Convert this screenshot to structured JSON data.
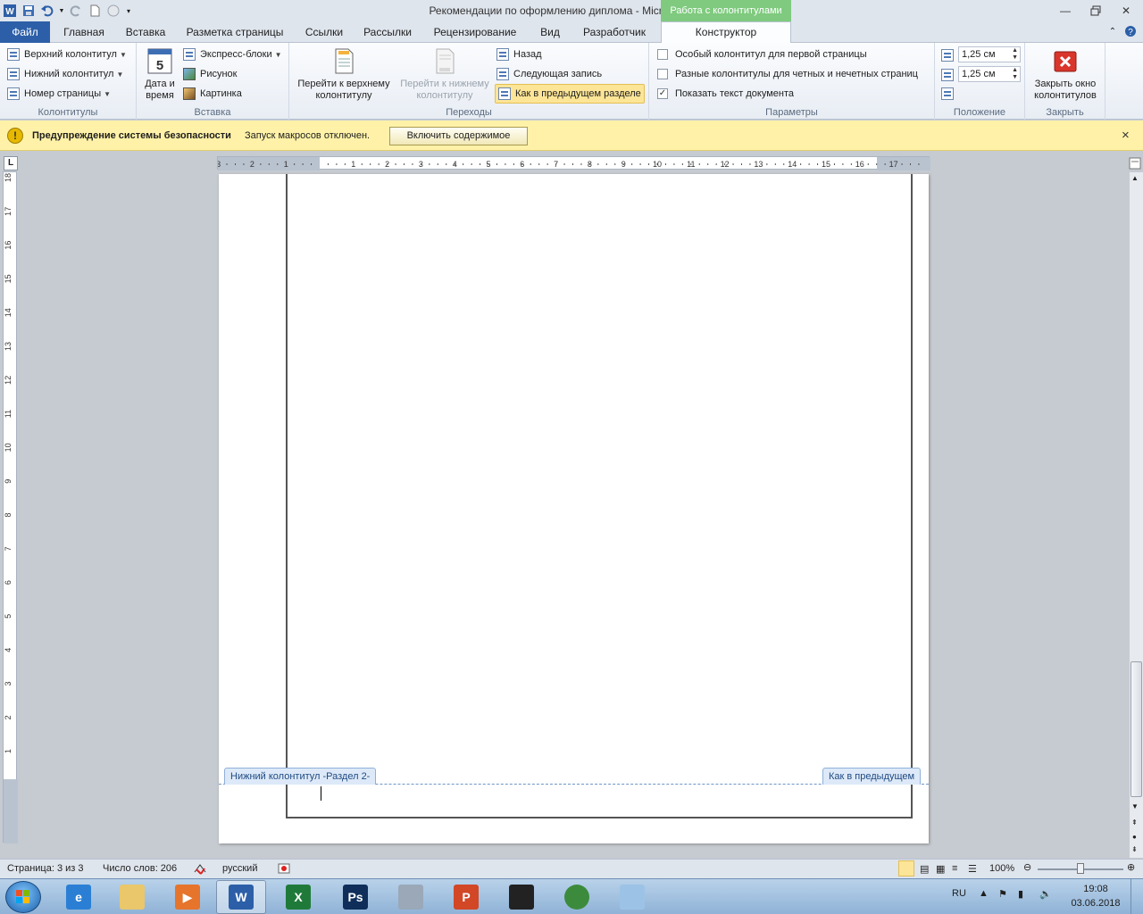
{
  "window": {
    "title": "Рекомендации по оформлению диплома  -  Microsoft Word",
    "context_tab_group": "Работа с колонтитулами"
  },
  "tabs": {
    "file": "Файл",
    "items": [
      "Главная",
      "Вставка",
      "Разметка страницы",
      "Ссылки",
      "Рассылки",
      "Рецензирование",
      "Вид"
    ],
    "addin": "Разработчик",
    "active": "Конструктор"
  },
  "ribbon": {
    "headers_group": {
      "label": "Колонтитулы",
      "header": "Верхний колонтитул",
      "footer": "Нижний колонтитул",
      "page_number": "Номер страницы"
    },
    "insert_group": {
      "label": "Вставка",
      "date_time": "Дата и время",
      "date_glyph": "5",
      "quick_parts": "Экспресс-блоки",
      "picture": "Рисунок",
      "clipart": "Картинка"
    },
    "nav_group": {
      "label": "Переходы",
      "goto_header": "Перейти к верхнему колонтитулу",
      "goto_footer": "Перейти к нижнему колонтитулу",
      "prev": "Назад",
      "next": "Следующая запись",
      "link_prev": "Как в предыдущем разделе"
    },
    "options_group": {
      "label": "Параметры",
      "diff_first": "Особый колонтитул для первой страницы",
      "diff_odd_even": "Разные колонтитулы для четных и нечетных страниц",
      "show_doc_text": "Показать текст документа",
      "show_doc_text_checked": true
    },
    "position_group": {
      "label": "Положение",
      "header_from_top": "1,25 см",
      "footer_from_bottom": "1,25 см"
    },
    "close_group": {
      "label": "Закрыть",
      "close": "Закрыть окно колонтитулов"
    }
  },
  "security_bar": {
    "title": "Предупреждение системы безопасности",
    "message": "Запуск макросов отключен.",
    "button": "Включить содержимое",
    "close": "×"
  },
  "ruler": {
    "horizontal_numbers": [
      "3",
      "2",
      "1",
      "1",
      "2",
      "3",
      "4",
      "5",
      "6",
      "7",
      "8",
      "9",
      "10",
      "11",
      "12",
      "13",
      "14",
      "15",
      "16",
      "17"
    ],
    "vertical_numbers": [
      "18",
      "17",
      "16",
      "15",
      "14",
      "13",
      "12",
      "11",
      "10",
      "9",
      "8",
      "7",
      "6",
      "5",
      "4",
      "3",
      "2",
      "1"
    ],
    "corner": "L"
  },
  "document": {
    "footer_tag": "Нижний колонтитул -Раздел 2-",
    "link_tag": "Как в предыдущем"
  },
  "status": {
    "page": "Страница: 3 из 3",
    "words": "Число слов: 206",
    "language": "русский",
    "zoom": "100%"
  },
  "taskbar": {
    "apps": [
      {
        "name": "ie",
        "glyph": "e",
        "color": "#2a7fd4"
      },
      {
        "name": "explorer",
        "glyph": "",
        "color": "#e9c76a"
      },
      {
        "name": "media",
        "glyph": "▶",
        "color": "#e6742b"
      },
      {
        "name": "word",
        "glyph": "W",
        "color": "#2c5fa8"
      },
      {
        "name": "excel",
        "glyph": "X",
        "color": "#1f7a3a"
      },
      {
        "name": "photoshop",
        "glyph": "Ps",
        "color": "#0f2f5a"
      },
      {
        "name": "calculator",
        "glyph": "",
        "color": "#9aa8b8"
      },
      {
        "name": "powerpoint",
        "glyph": "P",
        "color": "#d24726"
      },
      {
        "name": "video",
        "glyph": "",
        "color": "#222222"
      },
      {
        "name": "chrome",
        "glyph": "",
        "color": "#3c8b3c"
      },
      {
        "name": "notes",
        "glyph": "",
        "color": "#9cc3e6"
      }
    ],
    "lang": "RU",
    "time": "19:08",
    "date": "03.06.2018"
  }
}
